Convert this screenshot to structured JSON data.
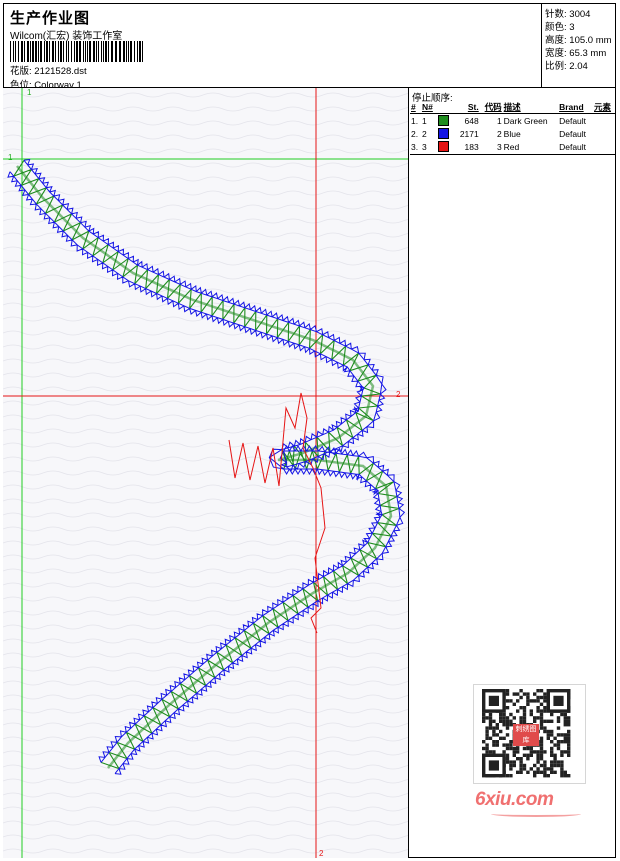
{
  "header": {
    "title": "生产作业图",
    "company": "Wilcom(汇宏) 装饰工作室",
    "design_label": "花版:",
    "design_value": "2121528.dst",
    "colorway_label": "色位:",
    "colorway_value": "Colorway 1"
  },
  "stats": {
    "stitches_label": "针数:",
    "stitches_value": "3004",
    "colors_label": "颜色:",
    "colors_value": "3",
    "height_label": "高度:",
    "height_value": "105.0 mm",
    "width_label": "宽度:",
    "width_value": "65.3 mm",
    "scale_label": "比例:",
    "scale_value": "2.04"
  },
  "stop_sequence": {
    "title": "停止顺序:",
    "columns": [
      "#",
      "N#",
      "St.",
      "代码",
      "描述",
      "Brand",
      "元素"
    ],
    "rows": [
      {
        "num": "1.",
        "n": "1",
        "stitches": "648",
        "code": "1",
        "desc": "Dark Green",
        "brand": "Default",
        "color": "#1e8c1e"
      },
      {
        "num": "2.",
        "n": "2",
        "stitches": "2171",
        "code": "2",
        "desc": "Blue",
        "brand": "Default",
        "color": "#1515e6"
      },
      {
        "num": "3.",
        "n": "3",
        "stitches": "183",
        "code": "3",
        "desc": "Red",
        "brand": "Default",
        "color": "#e61515"
      }
    ]
  },
  "design_view": {
    "marker_1": "1",
    "marker_2": "2",
    "guide_green": "#22cc22",
    "guide_red": "#e61515",
    "background": "#f7f7fa"
  },
  "watermark": {
    "site": "6xiu.com",
    "qr_badge": "刺绣图库"
  }
}
